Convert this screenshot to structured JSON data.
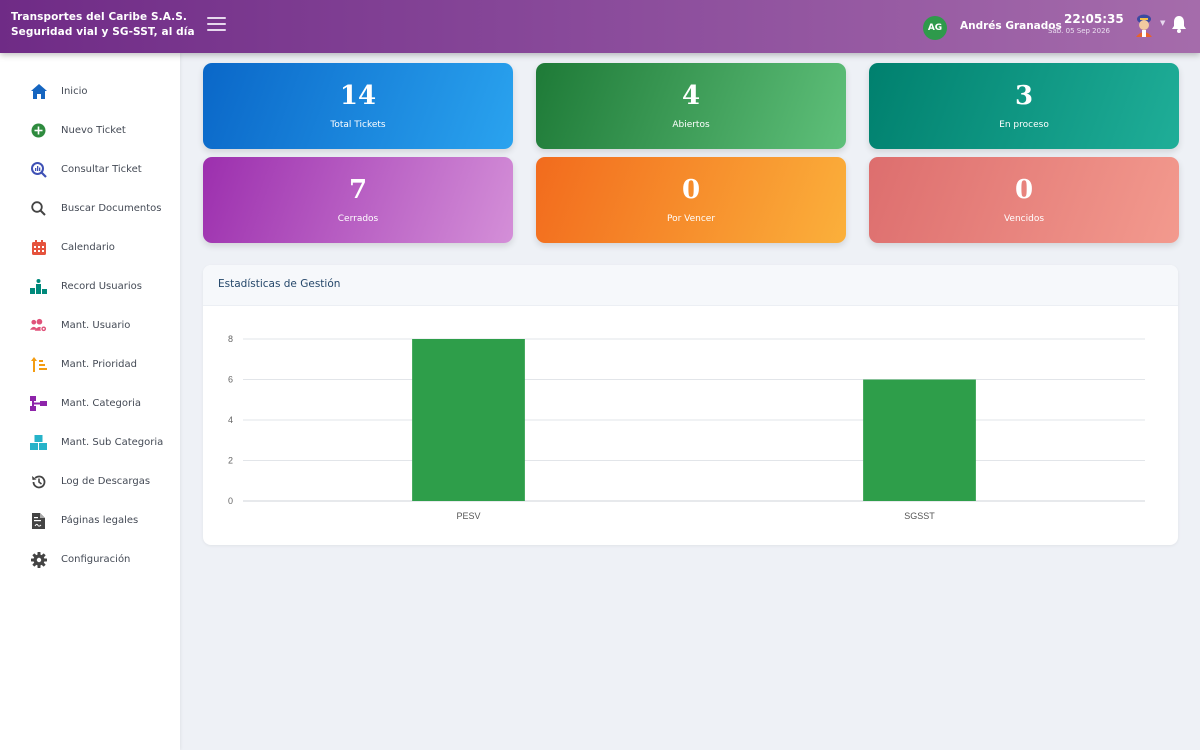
{
  "header": {
    "company_line1": "Transportes del Caribe S.A.S.",
    "company_line2": "Seguridad vial y SG-SST, al día",
    "user_initials": "AG",
    "user_name": "Andrés Granados",
    "time": "22:05:35",
    "date": "Sáb. 05 Sep 2026",
    "avatar_color": "#2e9a4b",
    "icons": [
      "menu-icon",
      "user-menu-icon",
      "caret-down-icon",
      "bell-icon"
    ]
  },
  "sidebar": {
    "items": [
      {
        "label": "Inicio",
        "icon": "home-icon",
        "color": "#1565c0"
      },
      {
        "label": "Nuevo Ticket",
        "icon": "plus-circle-icon",
        "color": "#2e8b3e"
      },
      {
        "label": "Consultar Ticket",
        "icon": "search-chart-icon",
        "color": "#3f51b5"
      },
      {
        "label": "Buscar Documentos",
        "icon": "search-icon",
        "color": "#444444"
      },
      {
        "label": "Calendario",
        "icon": "calendar-icon",
        "color": "#e5533d"
      },
      {
        "label": "Record Usuarios",
        "icon": "podium-icon",
        "color": "#00897b"
      },
      {
        "label": "Mant. Usuario",
        "icon": "users-cog-icon",
        "color": "#e0527a"
      },
      {
        "label": "Mant. Prioridad",
        "icon": "sort-priority-icon",
        "color": "#f39c12"
      },
      {
        "label": "Mant. Categoria",
        "icon": "sitemap-icon",
        "color": "#8e24aa"
      },
      {
        "label": "Mant. Sub Categoria",
        "icon": "boxes-icon",
        "color": "#26b3c9"
      },
      {
        "label": "Log de Descargas",
        "icon": "history-icon",
        "color": "#444444"
      },
      {
        "label": "Páginas legales",
        "icon": "file-contract-icon",
        "color": "#444444"
      },
      {
        "label": "Configuración",
        "icon": "gear-icon",
        "color": "#444444"
      }
    ]
  },
  "cards": [
    {
      "value": "14",
      "label": "Total Tickets",
      "from": "#0a67c8",
      "to": "#2aa3ef"
    },
    {
      "value": "4",
      "label": "Abiertos",
      "from": "#1e7a37",
      "to": "#5fc07a"
    },
    {
      "value": "3",
      "label": "En proceso",
      "from": "#00806e",
      "to": "#1fae98"
    },
    {
      "value": "7",
      "label": "Cerrados",
      "from": "#9c2fae",
      "to": "#d48fd8"
    },
    {
      "value": "0",
      "label": "Por Vencer",
      "from": "#f26b1d",
      "to": "#fbb03b"
    },
    {
      "value": "0",
      "label": "Vencidos",
      "from": "#dd6e6e",
      "to": "#f39a8e"
    }
  ],
  "stats": {
    "title": "Estadísticas de Gestión",
    "chart_data": {
      "type": "bar",
      "categories": [
        "PESV",
        "SGSST"
      ],
      "values": [
        8,
        6
      ],
      "ylim": [
        0,
        8
      ],
      "yticks": [
        0,
        2,
        4,
        6,
        8
      ],
      "grid": true,
      "bar_color": "#2e9e4a",
      "xlabel": "",
      "ylabel": ""
    }
  }
}
